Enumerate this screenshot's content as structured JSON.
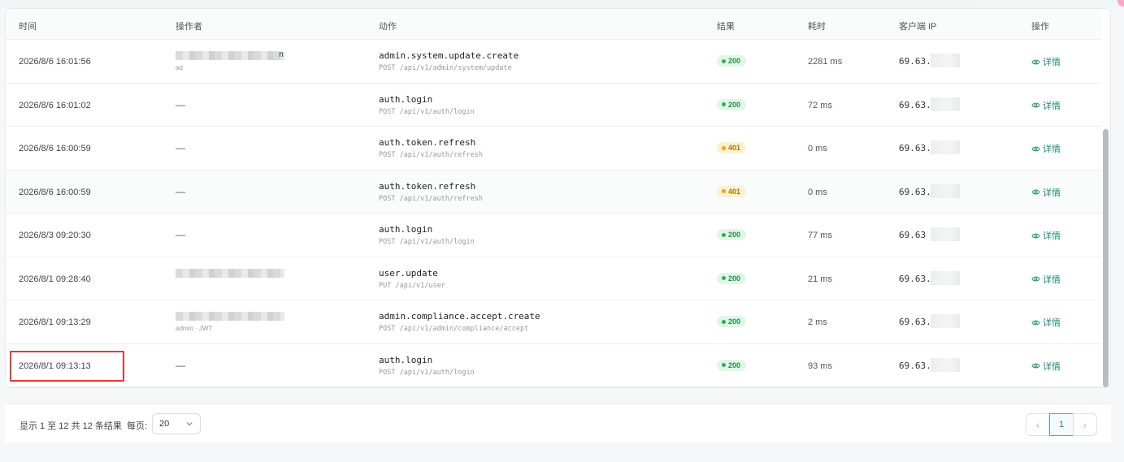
{
  "table": {
    "headers": {
      "time": "时间",
      "operator": "操作者",
      "action": "动作",
      "result": "结果",
      "duration": "耗时",
      "client_ip": "客户端 IP",
      "ops": "操作"
    },
    "detail_label": "详情",
    "rows": [
      {
        "time": "2026/8/6 16:01:56",
        "operator": "",
        "operator_tail": "n",
        "operator_sub": "ad",
        "action": "admin.system.update.create",
        "endpoint": "POST /api/v1/admin/system/update",
        "status": "200",
        "status_kind": "ok",
        "duration": "2281 ms",
        "ip": "69.63."
      },
      {
        "time": "2026/8/6 16:01:02",
        "operator": "—",
        "action": "auth.login",
        "endpoint": "POST /api/v1/auth/login",
        "status": "200",
        "status_kind": "ok",
        "duration": "72 ms",
        "ip": "69.63."
      },
      {
        "time": "2026/8/6 16:00:59",
        "operator": "—",
        "action": "auth.token.refresh",
        "endpoint": "POST /api/v1/auth/refresh",
        "status": "401",
        "status_kind": "warn",
        "duration": "0 ms",
        "ip": "69.63."
      },
      {
        "time": "2026/8/6 16:00:59",
        "operator": "—",
        "action": "auth.token.refresh",
        "endpoint": "POST /api/v1/auth/refresh",
        "status": "401",
        "status_kind": "warn",
        "duration": "0 ms",
        "ip": "69.63."
      },
      {
        "time": "2026/8/3 09:20:30",
        "operator": "—",
        "action": "auth.login",
        "endpoint": "POST /api/v1/auth/login",
        "status": "200",
        "status_kind": "ok",
        "duration": "77 ms",
        "ip": "69.63"
      },
      {
        "time": "2026/8/1 09:28:40",
        "operator": "",
        "action": "user.update",
        "endpoint": "PUT /api/v1/user",
        "status": "200",
        "status_kind": "ok",
        "duration": "21 ms",
        "ip": "69.63."
      },
      {
        "time": "2026/8/1 09:13:29",
        "operator": "",
        "operator_sub": "admin · JWT",
        "action": "admin.compliance.accept.create",
        "endpoint": "POST /api/v1/admin/compliance/accept",
        "status": "200",
        "status_kind": "ok",
        "duration": "2 ms",
        "ip": "69.63."
      },
      {
        "time": "2026/8/1 09:13:13",
        "operator": "—",
        "action": "auth.login",
        "endpoint": "POST /api/v1/auth/login",
        "status": "200",
        "status_kind": "ok",
        "duration": "93 ms",
        "ip": "69.63."
      }
    ]
  },
  "footer": {
    "summary": "显示 1 至 12 共 12 条结果",
    "per_page_label": "每页:",
    "per_page_value": "20",
    "current_page": "1",
    "prev_glyph": "‹",
    "next_glyph": "›"
  },
  "colors": {
    "accent": "#1d8a78",
    "ok": "#28b05a",
    "warn": "#f0a800",
    "highlight": "#e53935"
  }
}
